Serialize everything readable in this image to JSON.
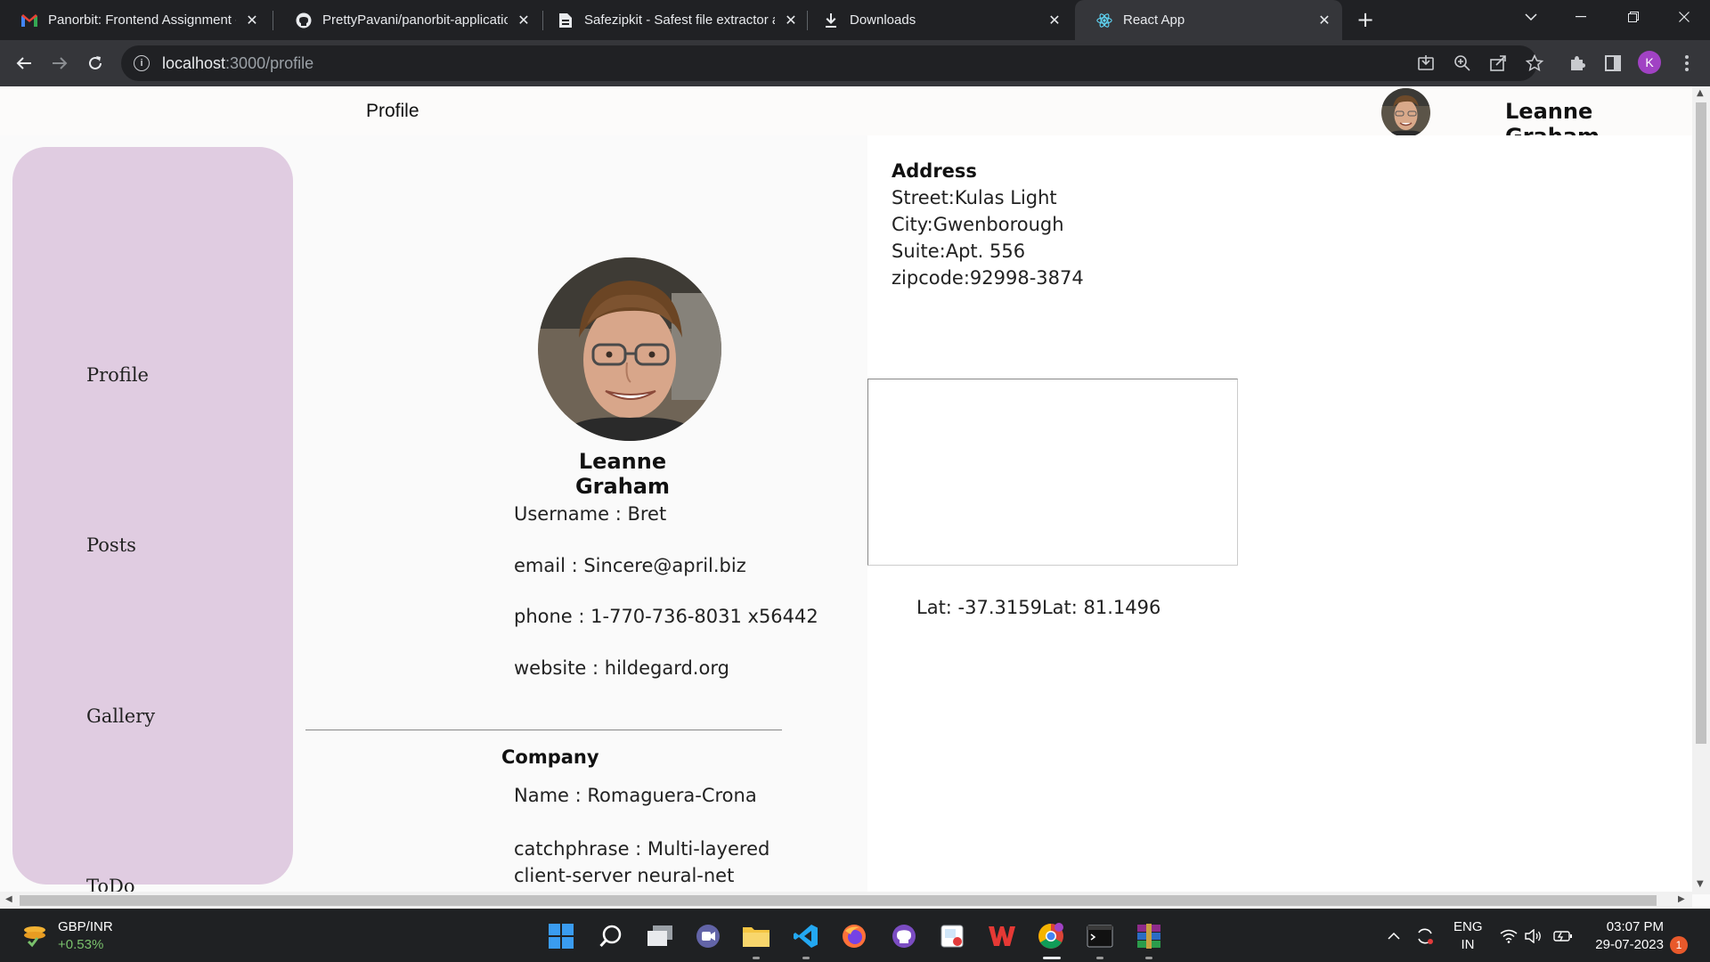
{
  "browser": {
    "tabs": [
      {
        "title": "Panorbit: Frontend Assignment -",
        "icon": "gmail-icon"
      },
      {
        "title": "PrettyPavani/panorbit-applicatior",
        "icon": "github-icon"
      },
      {
        "title": "Safezipkit - Safest file extractor ar",
        "icon": "document-icon"
      },
      {
        "title": "Downloads",
        "icon": "download-icon"
      },
      {
        "title": "React App",
        "icon": "react-icon",
        "active": true
      }
    ],
    "url_host": "localhost",
    "url_path": ":3000/profile",
    "profile_initial": "K"
  },
  "header": {
    "title": "Profile",
    "user_name": "Leanne Graham"
  },
  "sidebar": {
    "items": [
      "Profile",
      "Posts",
      "Gallery",
      "ToDo"
    ]
  },
  "profile": {
    "name": "Leanne Graham",
    "username": "Username : Bret",
    "email": "email : Sincere@april.biz",
    "phone": "phone : 1-770-736-8031 x56442",
    "website": "website : hildegard.org"
  },
  "company": {
    "title": "Company",
    "name": "Name : Romaguera-Crona",
    "catchphrase": "catchphrase : Multi-layered client-server neural-net"
  },
  "address": {
    "title": "Address",
    "street": "Street:Kulas Light",
    "city": "City:Gwenborough",
    "suite": "Suite:Apt. 556",
    "zipcode": "zipcode:92998-3874",
    "latlng": "Lat: -37.3159Lat: 81.1496"
  },
  "taskbar": {
    "ticker_name": "GBP/INR",
    "ticker_change": "+0.53%",
    "lang_line1": "ENG",
    "lang_line2": "IN",
    "time": "03:07 PM",
    "date": "29-07-2023",
    "notifications": "1"
  },
  "colors": {
    "sidebar_bg": "#e0cce1",
    "tab_bar_bg": "#202124",
    "toolbar_bg": "#35363a",
    "taskbar_bg": "#1f2123",
    "ticker_green": "#7ac16c"
  }
}
